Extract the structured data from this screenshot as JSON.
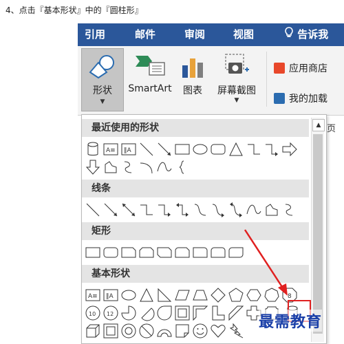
{
  "caption": "4、点击『基本形状』中的『圆柱形』",
  "tabs": [
    "引用",
    "邮件",
    "审阅",
    "视图"
  ],
  "tell_me": "告诉我",
  "ribbon": {
    "shapes_label": "形状",
    "smartart_label": "SmartArt",
    "chart_label": "图表",
    "screenshot_label": "屏幕截图",
    "app_store_label": "应用商店",
    "my_addins_label": "我的加载",
    "partial_label": "页"
  },
  "gallery": {
    "sections": [
      {
        "title": "最近使用的形状"
      },
      {
        "title": "线条"
      },
      {
        "title": "矩形"
      },
      {
        "title": "基本形状"
      }
    ]
  },
  "colors": {
    "ribbon_tab_bg": "#2b579a",
    "highlight": "#e02020",
    "watermark": "#1a3fa8"
  },
  "watermark": "最需教育"
}
